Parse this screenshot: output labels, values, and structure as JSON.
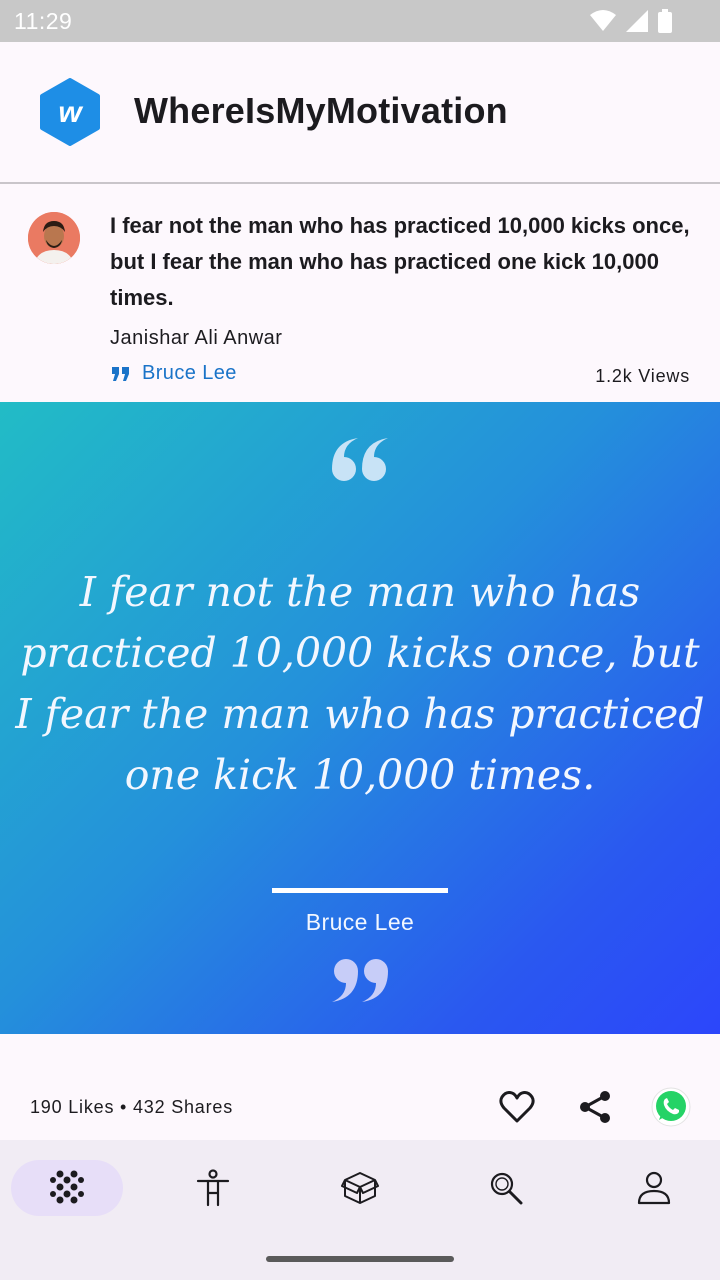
{
  "status_bar": {
    "time": "11:29"
  },
  "app": {
    "title": "WhereIsMyMotivation",
    "logo_letter": "w"
  },
  "post": {
    "quote": "I fear not the man who has practiced 10,000 kicks once, but I fear the man who has practiced one kick 10,000 times.",
    "poster": "Janishar Ali Anwar",
    "author": "Bruce Lee",
    "views": "1.2k Views"
  },
  "card": {
    "quote": "I fear not the man who has practiced 10,000 kicks once, but I fear the man who has practiced one kick 10,000 times.",
    "author": "Bruce Lee",
    "gradient": [
      "#22bcc6",
      "#2490db",
      "#2a58f0",
      "#2c46fb"
    ]
  },
  "stats": {
    "text": "190 Likes • 432 Shares"
  },
  "actions": [
    "heart-icon",
    "share-icon",
    "whatsapp-icon"
  ],
  "nav": {
    "items": [
      {
        "name": "nav-home",
        "icon": "dots-grid-icon",
        "active": true
      },
      {
        "name": "nav-motivation",
        "icon": "person-accessibility-icon",
        "active": false
      },
      {
        "name": "nav-packages",
        "icon": "package-icon",
        "active": false
      },
      {
        "name": "nav-search",
        "icon": "search-icon",
        "active": false
      },
      {
        "name": "nav-profile",
        "icon": "person-icon",
        "active": false
      }
    ]
  },
  "colors": {
    "accent": "#1a73c8",
    "logo": "#1e8ee6",
    "whatsapp": "#25d366",
    "nav_active": "#e7def8"
  }
}
